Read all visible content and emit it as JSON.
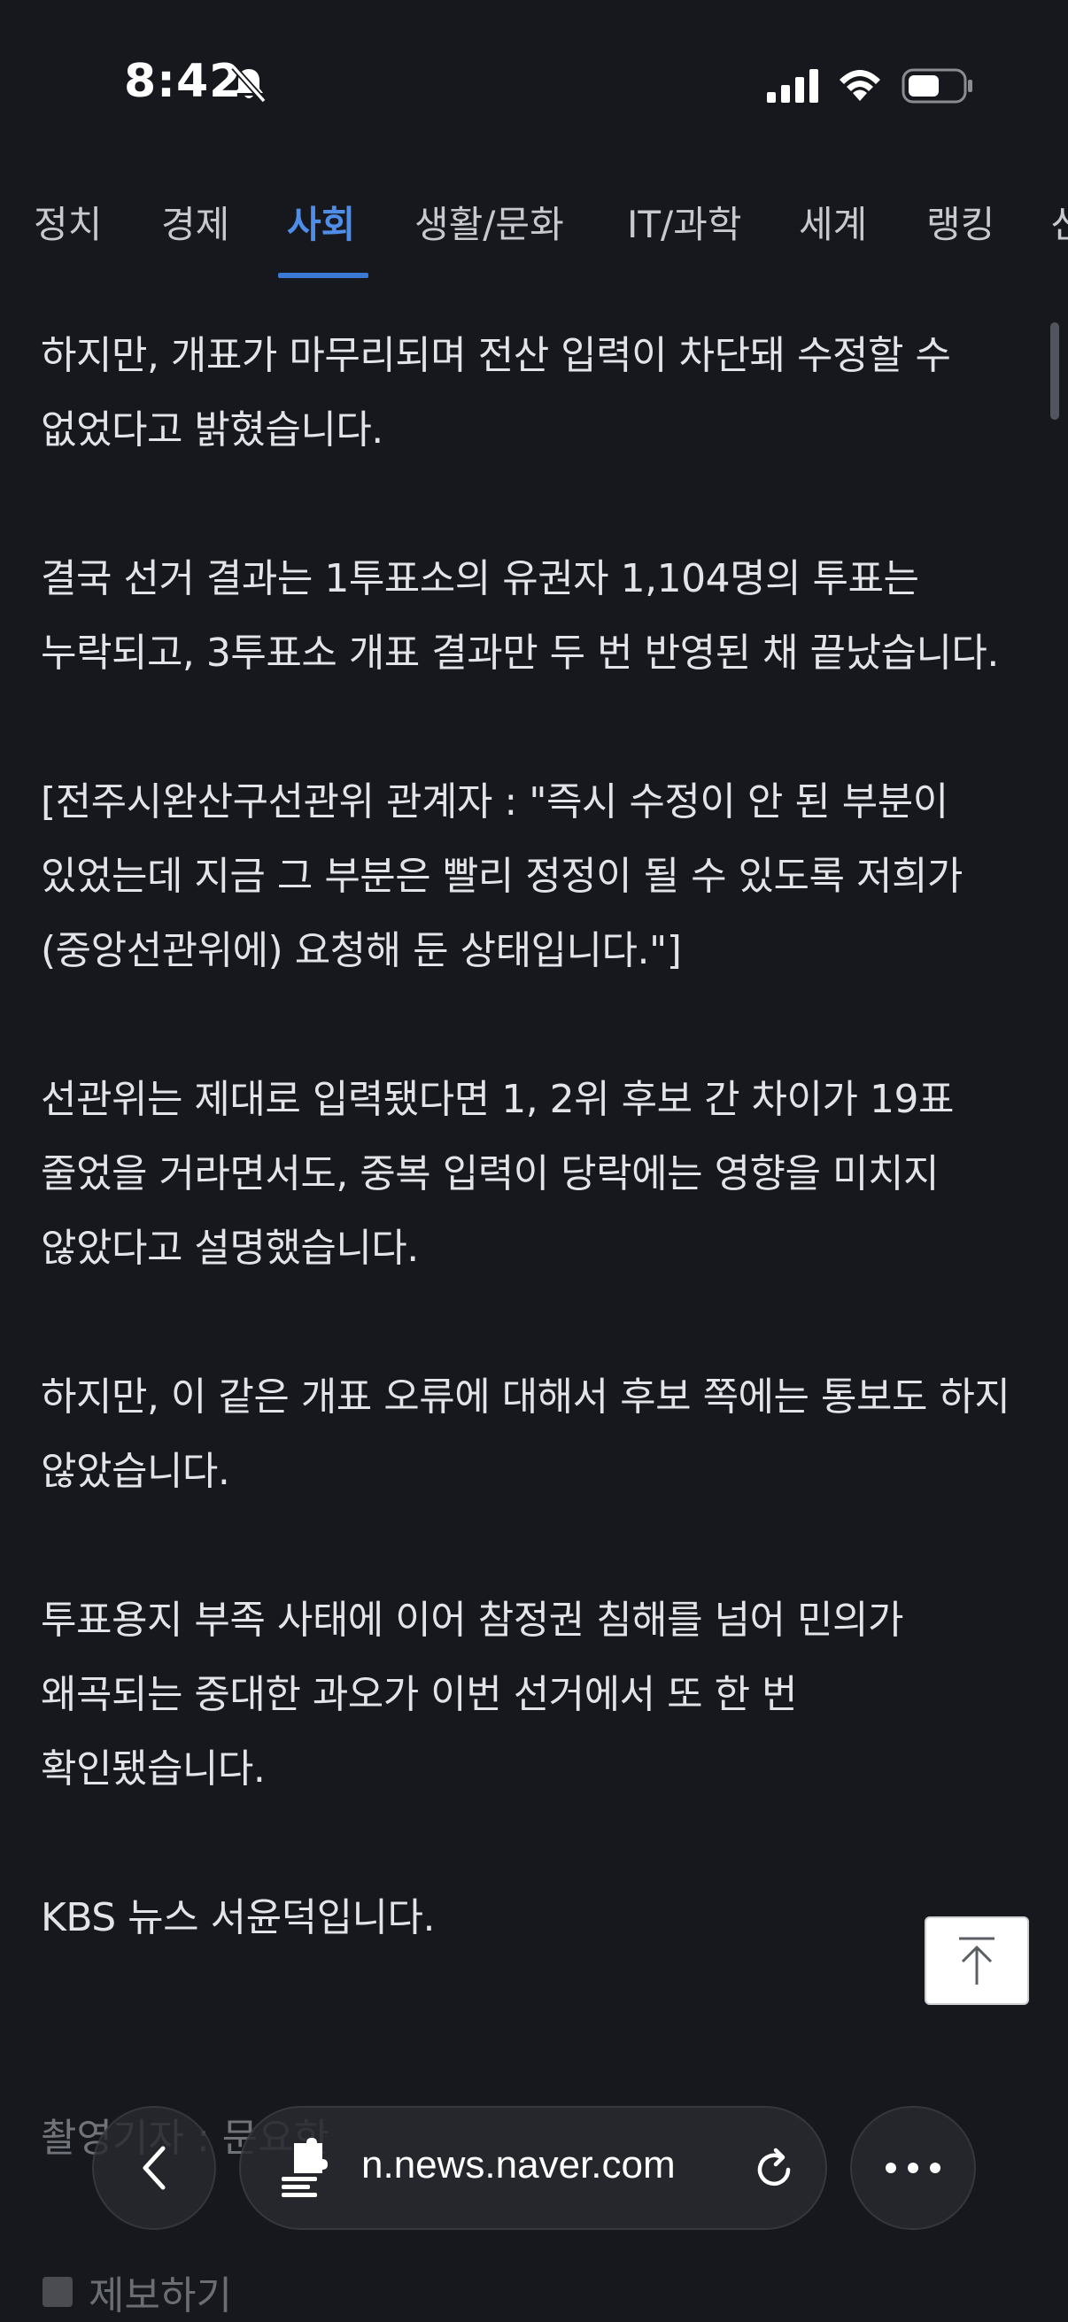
{
  "status_bar": {
    "time": "8:42"
  },
  "category_tabs": [
    {
      "label": "정치"
    },
    {
      "label": "경제"
    },
    {
      "label": "사회"
    },
    {
      "label": "생활/문화"
    },
    {
      "label": "IT/과학"
    },
    {
      "label": "세계"
    },
    {
      "label": "랭킹"
    },
    {
      "label": "신"
    }
  ],
  "active_tab": "사회",
  "article": {
    "paragraphs": [
      "하지만, 개표가 마무리되며 전산 입력이 차단돼 수정할 수 없었다고 밝혔습니다.",
      "결국 선거 결과는 1투표소의 유권자 1,104명의 투표는 누락되고, 3투표소 개표 결과만 두 번 반영된 채 끝났습니다.",
      "[전주시완산구선관위 관계자 : \"즉시 수정이 안 된 부분이 있었는데 지금 그 부분은 빨리 정정이 될 수 있도록 저희가 (중앙선관위에) 요청해 둔 상태입니다.\"]",
      "선관위는 제대로 입력됐다면 1, 2위 후보 간 차이가 19표 줄었을 거라면서도, 중복 입력이 당락에는 영향을 미치지 않았다고 설명했습니다.",
      "하지만, 이 같은 개표 오류에 대해서 후보 쪽에는 통보도 하지 않았습니다.",
      "투표용지 부족 사태에 이어 참정권 침해를 넘어 민의가 왜곡되는 중대한 과오가 이번 선거에서 또 한 번 확인됐습니다.",
      "KBS 뉴스 서윤덕입니다."
    ],
    "photo_credit": "촬영기자 : 문요한",
    "report_label": "제보하기"
  },
  "browser": {
    "url": "n.news.naver.com"
  },
  "colors": {
    "background": "#16181d",
    "text": "#e3e4e8",
    "accent": "#4e8de8"
  }
}
